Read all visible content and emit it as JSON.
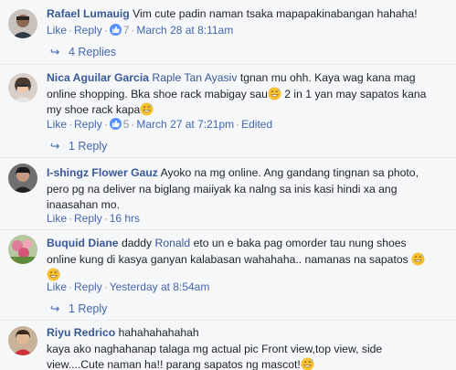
{
  "actions": {
    "like": "Like",
    "reply": "Reply"
  },
  "comments": [
    {
      "author": "Rafael Lumauig",
      "text": "Vim cute padin naman tsaka mapapakinabangan hahaha!",
      "likes": "7",
      "time": "March 28 at 8:11am",
      "replies": "4 Replies"
    },
    {
      "author": "Nica Aguilar Garcia",
      "mention": "Raple Tan Ayasiv",
      "text_1": "tgnan mu ohh. Kaya wag kana mag",
      "text_2": "online shopping. Bka shoe rack mabigay sau",
      "text_3": "2 in 1 yan may sapatos kana",
      "text_4": "my shoe rack kapa",
      "likes": "5",
      "time": "March 27 at 7:21pm",
      "edited": "Edited",
      "replies": "1 Reply"
    },
    {
      "author": "I-shingz Flower Gauz",
      "text_1": "Ayoko na mg online. Ang gandang tingnan sa photo,",
      "text_2": "pero pg na deliver na biglang maiiyak ka nalng sa inis kasi hindi xa ang",
      "text_3": "inaasahan mo.",
      "time": "16 hrs"
    },
    {
      "author": "Buquid Diane",
      "mention_plain": "daddy",
      "mention": "Ronald",
      "text_1": "eto un e baka pag omorder tau nung shoes",
      "text_2": "online kung di kasya ganyan kalabasan wahahaha.. namanas na sapatos",
      "time": "Yesterday at 8:54am",
      "replies": "1 Reply"
    },
    {
      "author": "Riyu Redrico",
      "text_1": "hahahahahahah",
      "text_2": "kaya ako naghahanap talaga mg actual pic Front view,top view, side",
      "text_3": "view....Cute naman ha!! parang sapatos ng mascot!"
    }
  ],
  "colors": {
    "link": "#385898",
    "action": "#4267b2",
    "meta": "#90949c",
    "like_badge": "#5890ff",
    "emoji": "#f7c131"
  }
}
